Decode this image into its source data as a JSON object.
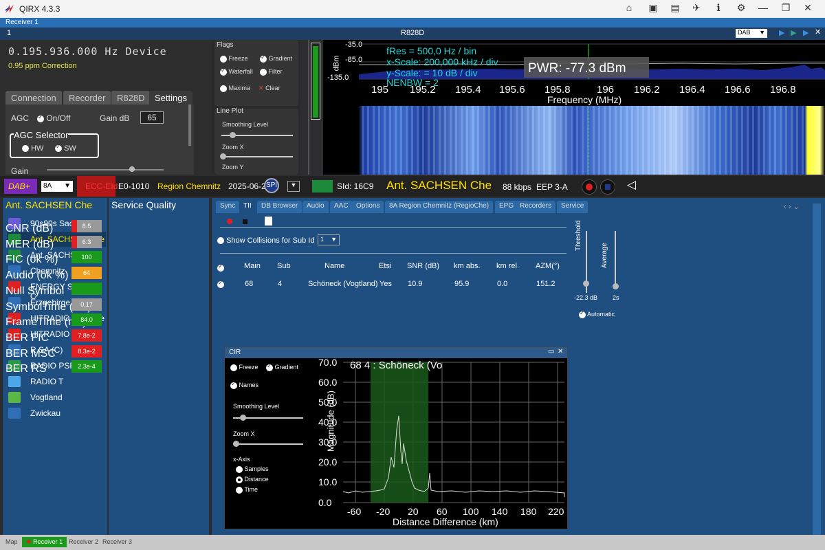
{
  "app": {
    "title": "QIRX 4.3.3",
    "receiver_tab": "Receiver 1",
    "device_num": "1",
    "device_name": "R828D",
    "mode": "DAB"
  },
  "device": {
    "frequency": "0.195.936.000 Hz Device",
    "ppm": "0.95 ppm Correction"
  },
  "tabs": [
    "Connection",
    "Recorder",
    "R828D",
    "Settings"
  ],
  "settings": {
    "agc": "AGC",
    "onoff": "On/Off",
    "gain_db": "Gain dB",
    "gain_val": "65",
    "agc_selector": "AGC Selector",
    "hw": "HW",
    "sw": "SW",
    "gain": "Gain"
  },
  "flags": {
    "title": "Flags",
    "freeze": "Freeze",
    "gradient": "Gradient",
    "waterfall": "Waterfall",
    "filter": "Filter",
    "maxima": "Maxima",
    "clear": "Clear",
    "lineplot": "Line Plot",
    "smoothing": "Smoothing Level",
    "zoomx": "Zoom X",
    "zoomy": "Zoom Y"
  },
  "spectrum": {
    "fres": "fRes = 500,0 Hz / bin",
    "xscale": "x-Scale: 200,000 kHz / div",
    "yscale": "y-Scale: = 10 dB / div",
    "nenbw": "NENBW = 2",
    "pwr": "PWR: -77.3 dBm",
    "ylabel": "dBm",
    "yticks": [
      "-35.0",
      "-85.0",
      "-135.0"
    ],
    "xticks": [
      "195",
      "195.2",
      "195.4",
      "195.6",
      "195.8",
      "196",
      "196.2",
      "196.4",
      "196.6",
      "196.8"
    ],
    "xlabel": "Frequency (MHz)"
  },
  "mainbar": {
    "dab": "DAB+",
    "channel": "8A",
    "ecc": "ECC-EId:",
    "ecc_val": "E0-1010",
    "region": "Region Chemnitz",
    "date": "2025-06-2",
    "spi": "SPI",
    "sid": "SId: 16C9",
    "station": "Ant. SACHSEN Che",
    "bitrate": "88 kbps",
    "eep": "EEP 3-A"
  },
  "services": {
    "header": "Ant. SACHSEN Che",
    "items": [
      {
        "label": "90s90s Sachsen C",
        "color": "#6b5bd6"
      },
      {
        "label": "Ant. SACHSEN Che",
        "color": "#1e8a3c"
      },
      {
        "label": "Ant. SACHSEN Vgt",
        "color": "#1e8a3c"
      },
      {
        "label": "Chemnitz",
        "color": "#2f6fb8"
      },
      {
        "label": "ENERGY Sachsen C",
        "color": "#e02020"
      },
      {
        "label": "Erzgebirge.",
        "color": "#2f6fb8"
      },
      {
        "label": "HITRADIO RTL Che",
        "color": "#e02020"
      },
      {
        "label": "HITRADIO RTL Vgt",
        "color": "#e02020"
      },
      {
        "label": "R.SA (C)",
        "color": "#2f6fb8"
      },
      {
        "label": "RADIO PSR (C)",
        "color": "#2a9a48"
      },
      {
        "label": "RADIO T",
        "color": "#4aa8e8"
      },
      {
        "label": "Vogtland",
        "color": "#5bb848"
      },
      {
        "label": "Zwickau",
        "color": "#2f6fb8"
      }
    ]
  },
  "quality": {
    "header": "Service Quality",
    "rows": [
      {
        "label": "CNR (dB)",
        "value": "8.5",
        "color": "#999999"
      },
      {
        "label": "MER (dB)",
        "value": "6.3",
        "color": "#999999"
      },
      {
        "label": "FIC (ok %)",
        "value": "100",
        "color": "#1a9a1a"
      },
      {
        "label": "Audio (ok %)",
        "value": "64",
        "color": "#f0a020"
      },
      {
        "label": "Null Symbol",
        "value": "",
        "color": "#1a9a1a"
      },
      {
        "label": "SymbolTime (ms)",
        "value": "0.17",
        "color": "#999999"
      },
      {
        "label": "FrameTime (ms)",
        "value": "84.0",
        "color": "#1a9a1a"
      },
      {
        "label": "BER FIC",
        "value": "7.8e-2",
        "color": "#e02020"
      },
      {
        "label": "BER MSC",
        "value": "8.3e-2",
        "color": "#e02020"
      },
      {
        "label": "BER RS",
        "value": "2.3e-4",
        "color": "#1a9a1a"
      }
    ]
  },
  "tii_tabs": [
    "Sync",
    "TII",
    "DB Browser",
    "Audio",
    "AAC",
    "Options",
    "8A Region Chemnitz (RegioChe)",
    "EPG",
    "Recorders",
    "Service"
  ],
  "tii": {
    "collisions": "Show Collisions for Sub Id",
    "columns": [
      "Main",
      "Sub",
      "Name",
      "Etsi",
      "SNR (dB)",
      "km abs.",
      "km rel.",
      "AZM(°)"
    ],
    "row": [
      "68",
      "4",
      "Schöneck (Vogtland)",
      "Yes",
      "10.9",
      "95.9",
      "0.0",
      "151.2"
    ],
    "threshold": "Threshold",
    "threshold_val": "-22.3 dB",
    "average": "Average",
    "average_val": "2s",
    "automatic": "Automatic"
  },
  "cir": {
    "title": "CIR",
    "freeze": "Freeze",
    "gradient": "Gradient",
    "names": "Names",
    "smoothing": "Smoothing Level",
    "zoomx": "Zoom X",
    "xaxis": "x-Axis",
    "samples": "Samples",
    "distance": "Distance",
    "time": "Time",
    "label": "68 4 : Schöneck (Vo",
    "ylabel": "Magnitude (dB)",
    "xlabel": "Distance Difference (km)",
    "yticks": [
      "70.0",
      "60.0",
      "50.0",
      "40.0",
      "30.0",
      "20.0",
      "10.0",
      "0.0"
    ],
    "xticks": [
      "-60",
      "-20",
      "20",
      "60",
      "100",
      "140",
      "180",
      "220"
    ]
  },
  "status": {
    "map": "Map",
    "r1": "Receiver 1",
    "r2": "Receiver 2",
    "r3": "Receiver 3"
  }
}
